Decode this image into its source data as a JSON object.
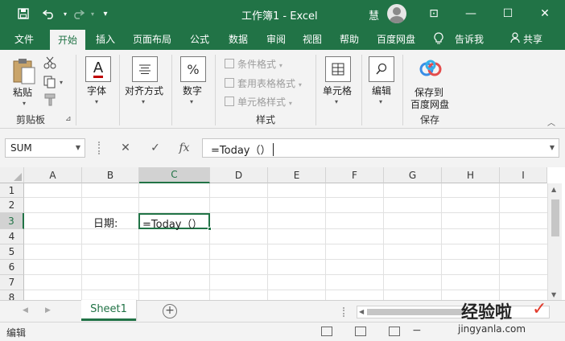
{
  "window": {
    "title": "工作簿1 - Excel",
    "user": "慧",
    "minimize": "—",
    "maximize": "☐",
    "close": "✕",
    "ribbon_display": "⊡"
  },
  "quick_access": {
    "save_icon": "save-icon",
    "undo_icon": "undo-icon",
    "redo_icon": "redo-icon",
    "customize": "▾"
  },
  "tabs": [
    "文件",
    "开始",
    "插入",
    "页面布局",
    "公式",
    "数据",
    "审阅",
    "视图",
    "帮助",
    "百度网盘",
    "告诉我",
    "共享"
  ],
  "active_tab": "开始",
  "ribbon": {
    "clipboard": {
      "paste": "粘贴",
      "group": "剪贴板"
    },
    "font": {
      "label": "字体"
    },
    "alignment": {
      "label": "对齐方式"
    },
    "number": {
      "label": "数字"
    },
    "styles": {
      "conditional": "条件格式",
      "table": "套用表格格式",
      "cell_styles": "单元格样式",
      "group": "样式"
    },
    "cells": {
      "label": "单元格"
    },
    "editing": {
      "label": "编辑"
    },
    "save": {
      "line1": "保存到",
      "line2": "百度网盘",
      "group": "保存"
    }
  },
  "formula_bar": {
    "name_box": "SUM",
    "cancel": "✕",
    "enter": "✓",
    "fx": "fx",
    "content": "=Today（）"
  },
  "columns": [
    "A",
    "B",
    "C",
    "D",
    "E",
    "F",
    "G",
    "H",
    "I"
  ],
  "rows": [
    "1",
    "2",
    "3",
    "4",
    "5",
    "6",
    "7",
    "8"
  ],
  "cells": {
    "B3": "日期:",
    "C3": "=Today（）"
  },
  "sheets": [
    "Sheet1"
  ],
  "status": {
    "mode": "编辑"
  },
  "watermark": {
    "text": "经验啦",
    "url": "jingyanla.com"
  }
}
